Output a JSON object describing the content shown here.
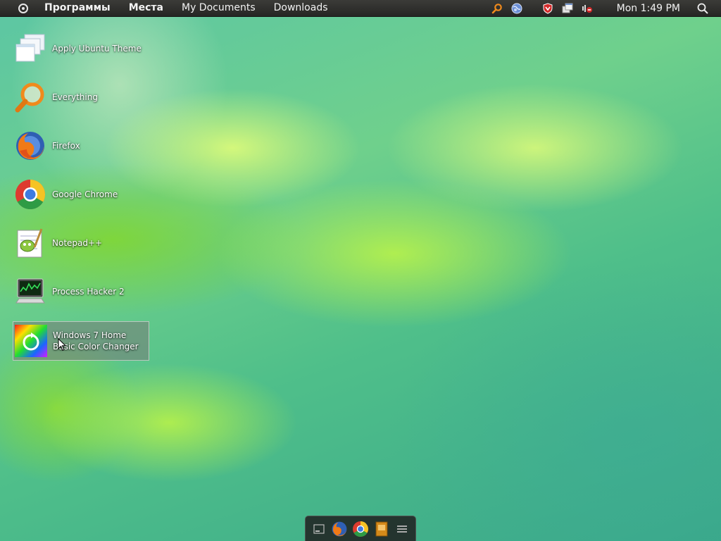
{
  "panel": {
    "menu": [
      "Программы",
      "Места",
      "My Documents",
      "Downloads"
    ],
    "clock": "Mon 1:49 PM",
    "tray_icons": [
      "search-tray-icon",
      "network-globe-icon",
      "shield-icon",
      "window-switch-icon",
      "volume-muted-icon"
    ]
  },
  "desktop": {
    "icons": [
      {
        "label": "Apply Ubuntu Theme",
        "icon": "windows-stack-icon"
      },
      {
        "label": "Everything",
        "icon": "magnifier-icon"
      },
      {
        "label": "Firefox",
        "icon": "firefox-icon"
      },
      {
        "label": "Google Chrome",
        "icon": "chrome-icon"
      },
      {
        "label": "Notepad++",
        "icon": "notepad-plus-plus-icon"
      },
      {
        "label": "Process Hacker 2",
        "icon": "process-hacker-icon"
      },
      {
        "label": "Windows 7 Home Basic Color Changer",
        "icon": "color-wheel-icon",
        "selected": true
      }
    ]
  },
  "dock": {
    "items": [
      "desktop-icon",
      "firefox-icon",
      "chrome-icon",
      "notepad-icon",
      "menu-icon"
    ]
  },
  "colors": {
    "panel_bg": "#2e2e2c",
    "accent_orange": "#f08a1c",
    "wallpaper_green": "#6fd08c"
  }
}
